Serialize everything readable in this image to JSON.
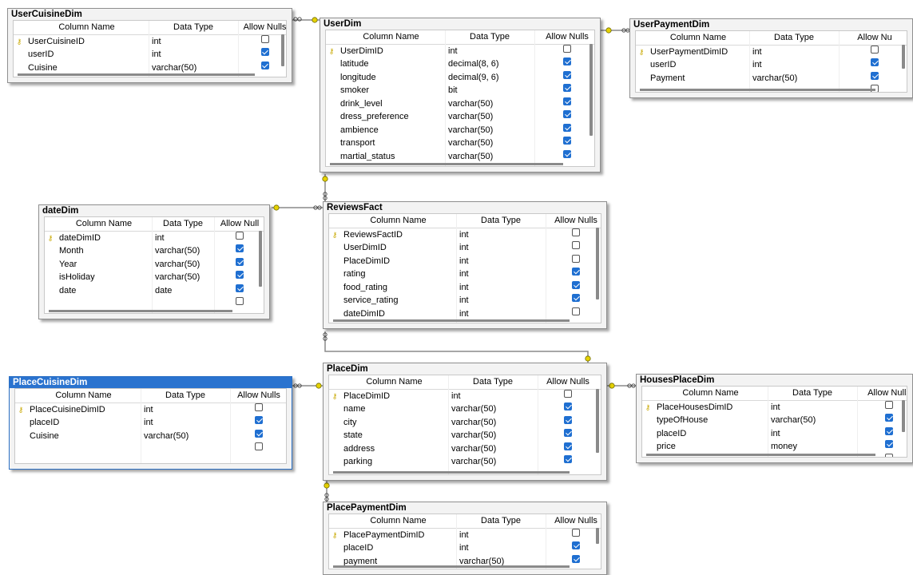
{
  "headers": {
    "col1": "Column Name",
    "col2": "Data Type",
    "col3": "Allow Nulls",
    "col3_short": "Allow Null",
    "col3_cut": "Allow Nu"
  },
  "tables": [
    {
      "id": "UserCuisineDim",
      "title": "UserCuisineDim",
      "rows": [
        {
          "name": "UserCuisineID",
          "type": "int",
          "nulls": false,
          "pk": true
        },
        {
          "name": "userID",
          "type": "int",
          "nulls": true
        },
        {
          "name": "Cuisine",
          "type": "varchar(50)",
          "nulls": true
        }
      ]
    },
    {
      "id": "UserDim",
      "title": "UserDim",
      "rows": [
        {
          "name": "UserDimID",
          "type": "int",
          "nulls": false,
          "pk": true
        },
        {
          "name": "latitude",
          "type": "decimal(8, 6)",
          "nulls": true
        },
        {
          "name": "longitude",
          "type": "decimal(9, 6)",
          "nulls": true
        },
        {
          "name": "smoker",
          "type": "bit",
          "nulls": true
        },
        {
          "name": "drink_level",
          "type": "varchar(50)",
          "nulls": true
        },
        {
          "name": "dress_preference",
          "type": "varchar(50)",
          "nulls": true
        },
        {
          "name": "ambience",
          "type": "varchar(50)",
          "nulls": true
        },
        {
          "name": "transport",
          "type": "varchar(50)",
          "nulls": true
        },
        {
          "name": "martial_status",
          "type": "varchar(50)",
          "nulls": true
        }
      ]
    },
    {
      "id": "UserPaymentDim",
      "title": "UserPaymentDim",
      "rows": [
        {
          "name": "UserPaymentDimID",
          "type": "int",
          "nulls": false,
          "pk": true
        },
        {
          "name": "userID",
          "type": "int",
          "nulls": true
        },
        {
          "name": "Payment",
          "type": "varchar(50)",
          "nulls": true
        }
      ]
    },
    {
      "id": "dateDim",
      "title": "dateDim",
      "rows": [
        {
          "name": "dateDimID",
          "type": "int",
          "nulls": false,
          "pk": true
        },
        {
          "name": "Month",
          "type": "varchar(50)",
          "nulls": true
        },
        {
          "name": "Year",
          "type": "varchar(50)",
          "nulls": true
        },
        {
          "name": "isHoliday",
          "type": "varchar(50)",
          "nulls": true
        },
        {
          "name": "date",
          "type": "date",
          "nulls": true
        }
      ]
    },
    {
      "id": "ReviewsFact",
      "title": "ReviewsFact",
      "rows": [
        {
          "name": "ReviewsFactID",
          "type": "int",
          "nulls": false,
          "pk": true
        },
        {
          "name": "UserDimID",
          "type": "int",
          "nulls": false
        },
        {
          "name": "PlaceDimID",
          "type": "int",
          "nulls": false
        },
        {
          "name": "rating",
          "type": "int",
          "nulls": true
        },
        {
          "name": "food_rating",
          "type": "int",
          "nulls": true
        },
        {
          "name": "service_rating",
          "type": "int",
          "nulls": true
        },
        {
          "name": "dateDimID",
          "type": "int",
          "nulls": false
        }
      ]
    },
    {
      "id": "PlaceCuisineDim",
      "title": "PlaceCuisineDim",
      "rows": [
        {
          "name": "PlaceCuisineDimID",
          "type": "int",
          "nulls": false,
          "pk": true
        },
        {
          "name": "placeID",
          "type": "int",
          "nulls": true
        },
        {
          "name": "Cuisine",
          "type": "varchar(50)",
          "nulls": true
        }
      ]
    },
    {
      "id": "PlaceDim",
      "title": "PlaceDim",
      "rows": [
        {
          "name": "PlaceDimID",
          "type": "int",
          "nulls": false,
          "pk": true
        },
        {
          "name": "name",
          "type": "varchar(50)",
          "nulls": true
        },
        {
          "name": "city",
          "type": "varchar(50)",
          "nulls": true
        },
        {
          "name": "state",
          "type": "varchar(50)",
          "nulls": true
        },
        {
          "name": "address",
          "type": "varchar(50)",
          "nulls": true
        },
        {
          "name": "parking",
          "type": "varchar(50)",
          "nulls": true
        }
      ]
    },
    {
      "id": "HousesPlaceDim",
      "title": "HousesPlaceDim",
      "rows": [
        {
          "name": "PlaceHousesDimID",
          "type": "int",
          "nulls": false,
          "pk": true
        },
        {
          "name": "typeOfHouse",
          "type": "varchar(50)",
          "nulls": true
        },
        {
          "name": "placeID",
          "type": "int",
          "nulls": true
        },
        {
          "name": "price",
          "type": "money",
          "nulls": true
        }
      ]
    },
    {
      "id": "PlacePaymentDim",
      "title": "PlacePaymentDim",
      "rows": [
        {
          "name": "PlacePaymentDimID",
          "type": "int",
          "nulls": false,
          "pk": true
        },
        {
          "name": "placeID",
          "type": "int",
          "nulls": true
        },
        {
          "name": "payment",
          "type": "varchar(50)",
          "nulls": true
        }
      ]
    }
  ]
}
